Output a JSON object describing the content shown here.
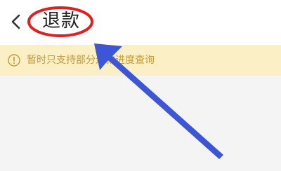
{
  "header": {
    "back_icon": "chevron-left-icon",
    "title": "退款"
  },
  "notice": {
    "icon": "info-circle-icon",
    "text": "暂时只支持部分退款进度查询"
  },
  "colors": {
    "notice_background": "#fbefc6",
    "notice_text": "#c39b3a",
    "annotation_red": "#e02020",
    "annotation_blue": "#3d56d6"
  }
}
